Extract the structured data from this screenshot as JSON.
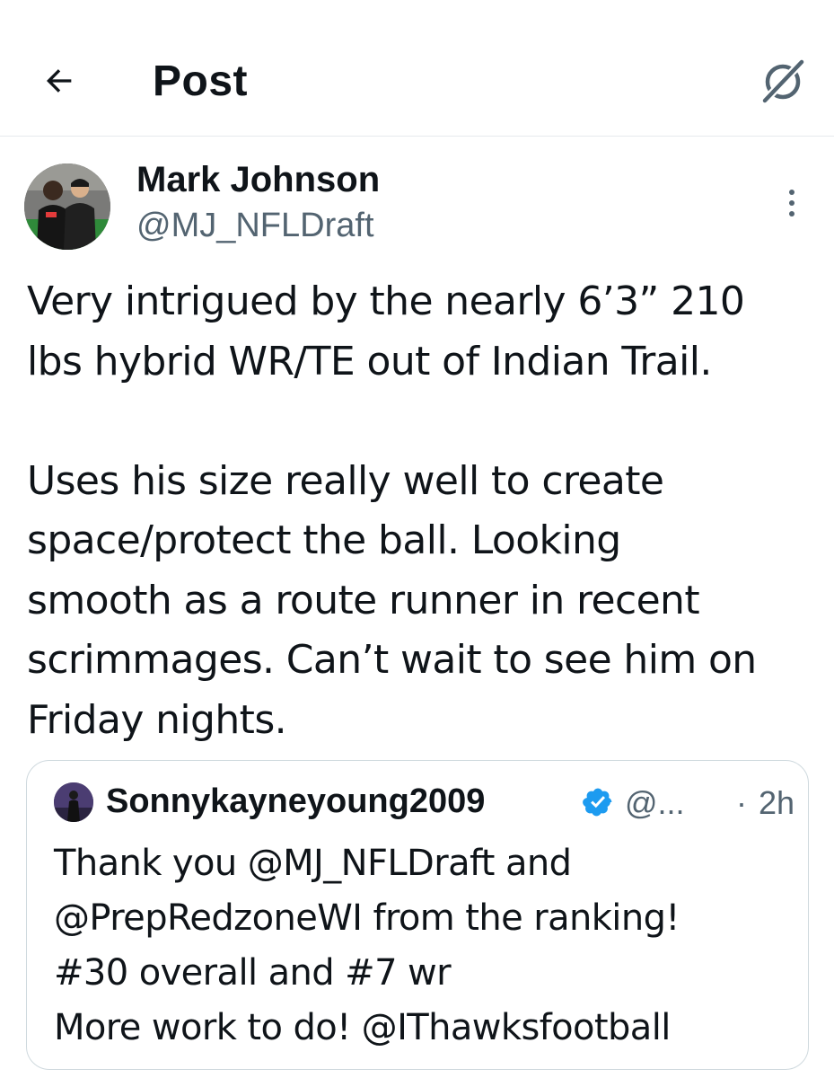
{
  "header": {
    "title": "Post",
    "back_icon": "arrow-left-icon",
    "grok_icon": "grok-icon"
  },
  "post": {
    "author": {
      "name": "Mark Johnson",
      "handle": "@MJ_NFLDraft",
      "avatar_icon": "profile-photo"
    },
    "more_icon": "more-vertical-icon",
    "text": "Very intrigued by the nearly 6’3” 210\nlbs hybrid WR/TE out of Indian Trail.\n\nUses his size really well to create\nspace/protect the ball. Looking\nsmooth as a route runner in recent\nscrimmages. Can’t wait to see him on\nFriday nights."
  },
  "quoted_post": {
    "author": {
      "name": "Sonnykayneyoung2009",
      "handle": "@...",
      "verified": true,
      "verified_color": "#1d9bf0"
    },
    "separator": "·",
    "time": "2h",
    "text": "Thank you @MJ_NFLDraft and\n@PrepRedzoneWI from the ranking!\n#30 overall and #7 wr\nMore work to do! @IThawksfootball"
  },
  "colors": {
    "text": "#0f1419",
    "secondary": "#536471",
    "border": "#cfd9de",
    "verified": "#1d9bf0"
  }
}
